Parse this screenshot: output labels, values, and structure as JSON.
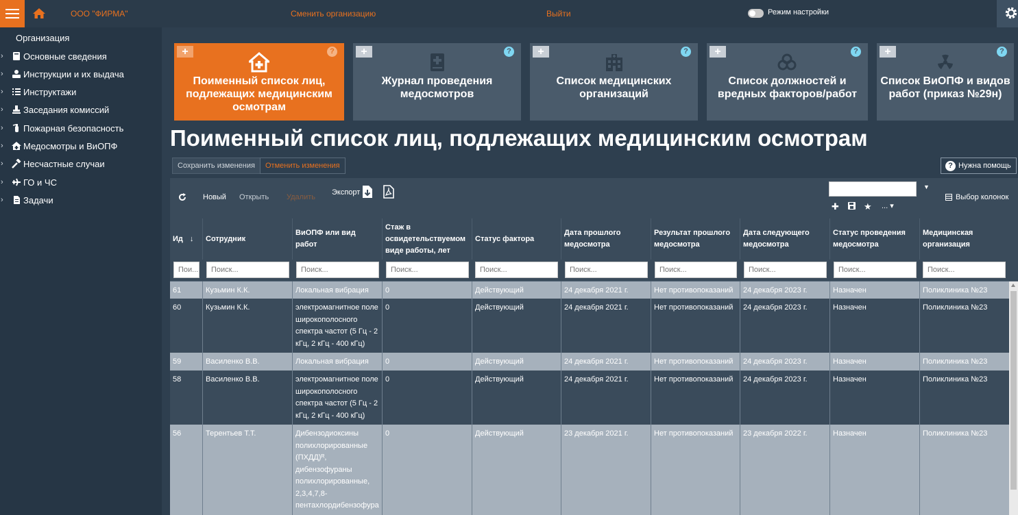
{
  "topbar": {
    "org_name": "ООО \"ФИРМА\"",
    "change_org": "Сменить организацию",
    "logout": "Выйти",
    "settings_mode": "Режим настройки"
  },
  "sidebar": {
    "title": "Организация",
    "items": [
      {
        "label": "Основные сведения",
        "icon": "book-icon"
      },
      {
        "label": "Инструкции и их выдача",
        "icon": "user-card-icon"
      },
      {
        "label": "Инструктажи",
        "icon": "list-icon"
      },
      {
        "label": "Заседания комиссий",
        "icon": "stamp-icon"
      },
      {
        "label": "Пожарная безопасность",
        "icon": "fire-extinguisher-icon"
      },
      {
        "label": "Медосмотры и ВиОПФ",
        "icon": "medical-house-icon"
      },
      {
        "label": "Несчастные случаи",
        "icon": "hammer-icon"
      },
      {
        "label": "ГО и ЧС",
        "icon": "plane-icon"
      },
      {
        "label": "Задачи",
        "icon": "document-icon"
      }
    ]
  },
  "tiles": [
    {
      "label": "Поименный список лиц, подлежащих медицинским осмотрам",
      "icon": "medical-house-icon",
      "active": true
    },
    {
      "label": "Журнал проведения медосмотров",
      "icon": "medical-book-icon",
      "active": false
    },
    {
      "label": "Список медицинских организаций",
      "icon": "hospital-icon",
      "active": false
    },
    {
      "label": "Список должностей и вредных факторов/работ",
      "icon": "biohazard-icon",
      "active": false
    },
    {
      "label": "Список ВиОПФ и видов работ (приказ №29н)",
      "icon": "radiation-icon",
      "active": false
    }
  ],
  "page": {
    "title": "Поименный список лиц, подлежащих медицинским осмотрам",
    "save_changes": "Сохранить изменения",
    "cancel_changes": "Отменить изменения",
    "need_help": "Нужна помощь"
  },
  "toolbar": {
    "new": "Новый",
    "open": "Открыть",
    "delete": "Удалить",
    "export": "Экспорт",
    "select_columns": "Выбор колонок",
    "more": "..."
  },
  "table": {
    "columns": [
      "Ид",
      "Сотрудник",
      "ВиОПФ или вид работ",
      "Стаж в освидетельствуемом виде работы, лет",
      "Статус фактора",
      "Дата прошлого медосмотра",
      "Результат прошлого медосмотра",
      "Дата следующего медосмотра",
      "Статус проведения медосмотра",
      "Медицинская организация"
    ],
    "filter_placeholders": [
      "Пои...",
      "Поиск...",
      "Поиск...",
      "Поиск...",
      "Поиск...",
      "Поиск...",
      "Поиск...",
      "Поиск...",
      "Поиск...",
      "Поиск..."
    ],
    "rows": [
      [
        "61",
        "Кузьмин К.К.",
        "Локальная вибрация",
        "0",
        "Действующий",
        "24 декабря 2021 г.",
        "Нет противопоказаний",
        "24 декабря 2023 г.",
        "Назначен",
        "Поликлиника №23"
      ],
      [
        "60",
        "Кузьмин К.К.",
        "электромагнитное поле широкополосного спектра частот  (5 Гц - 2 кГц, 2 кГц - 400 кГц)",
        "0",
        "Действующий",
        "24 декабря 2021 г.",
        "Нет противопоказаний",
        "24 декабря 2023 г.",
        "Назначен",
        "Поликлиника №23"
      ],
      [
        "59",
        "Василенко В.В.",
        "Локальная вибрация",
        "0",
        "Действующий",
        "24 декабря 2021 г.",
        "Нет противопоказаний",
        "24 декабря 2023 г.",
        "Назначен",
        "Поликлиника №23"
      ],
      [
        "58",
        "Василенко В.В.",
        "электромагнитное поле широкополосного спектра частот  (5 Гц - 2 кГц, 2 кГц - 400 кГц)",
        "0",
        "Действующий",
        "24 декабря 2021 г.",
        "Нет противопоказаний",
        "24 декабря 2023 г.",
        "Назначен",
        "Поликлиника №23"
      ],
      [
        "56",
        "Терентьев Т.Т.",
        "Дибензодиоксины полихлорированные (ПХДД)ᴿ, дибензофураны полихлорированные, 2,3,4,7,8-пентахлордибензофура",
        "0",
        "Действующий",
        "23 декабря 2021 г.",
        "Нет противопоказаний",
        "23 декабря 2022 г.",
        "Назначен",
        "Поликлиника №23"
      ]
    ]
  },
  "colors": {
    "accent": "#e8711f",
    "background": "#2e3f4f",
    "sidebar": "#263645",
    "tile": "#4a5b6b",
    "row_light": "#a6b1bc",
    "row_dark": "#3a4b5b"
  }
}
